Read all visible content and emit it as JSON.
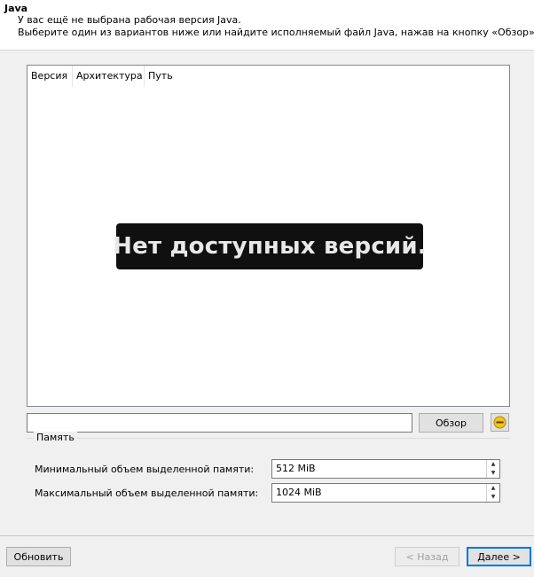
{
  "header": {
    "title": "Java",
    "line1": "У вас ещё не выбрана рабочая версия Java.",
    "line2": "Выберите один из вариантов ниже или найдите исполняемый файл Java, нажав на кнопку «Обзор»."
  },
  "table": {
    "columns": [
      "Версия",
      "Архитектура",
      "Путь"
    ],
    "empty_message": "Нет доступных версий."
  },
  "path_input": {
    "value": ""
  },
  "buttons": {
    "browse": "Обзор",
    "refresh": "Обновить",
    "back": "< Назад",
    "next": "Далее >"
  },
  "status": {
    "icon": "minus-circle-icon",
    "color": "#f0c419"
  },
  "memory": {
    "title": "Память",
    "min_label": "Минимальный объем выделенной памяти:",
    "min_value": "512 MiB",
    "max_label": "Максимальный объем выделенной памяти:",
    "max_value": "1024 MiB"
  }
}
